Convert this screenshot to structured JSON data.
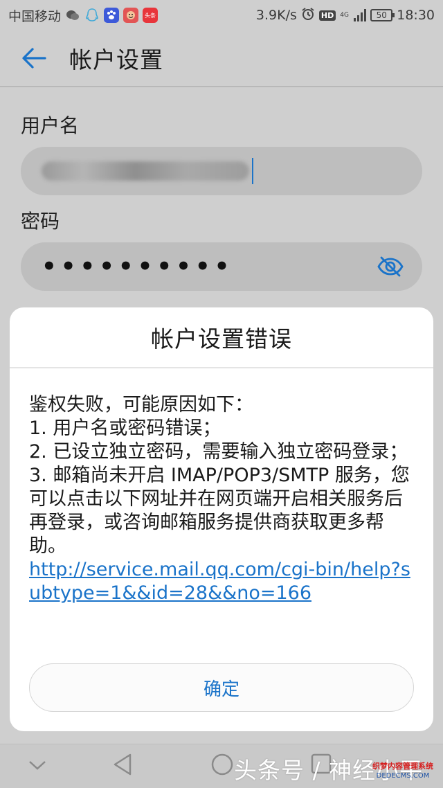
{
  "status_bar": {
    "carrier": "中国移动",
    "speed": "3.9K/s",
    "hd": "HD",
    "network": "4G",
    "battery": "50",
    "time": "18:30",
    "toutiao_badge": "头条"
  },
  "app_bar": {
    "title": "帐户设置"
  },
  "form": {
    "username_label": "用户名",
    "password_label": "密码",
    "password_value": "••••••••••"
  },
  "dialog": {
    "title": "帐户设置错误",
    "lines": [
      "鉴权失败，可能原因如下：",
      "1. 用户名或密码错误；",
      "2. 已设立独立密码，需要输入独立密码登录；",
      "3. 邮箱尚未开启 IMAP/POP3/SMTP 服务，您可以点击以下网址并在网页端开启相关服务后再登录，或咨询邮箱服务提供商获取更多帮助。"
    ],
    "link": "http://service.mail.qq.com/cgi-bin/help?subtype=1&&id=28&&no=166",
    "ok_label": "确定"
  },
  "watermark": "头条号 / 神经小平",
  "corner_logo": {
    "line1": "织梦内容管理系统",
    "line2": "DEDECMS.COM"
  },
  "colors": {
    "accent": "#1a73c9",
    "background": "#cfcfcf",
    "dialog": "#ffffff"
  }
}
